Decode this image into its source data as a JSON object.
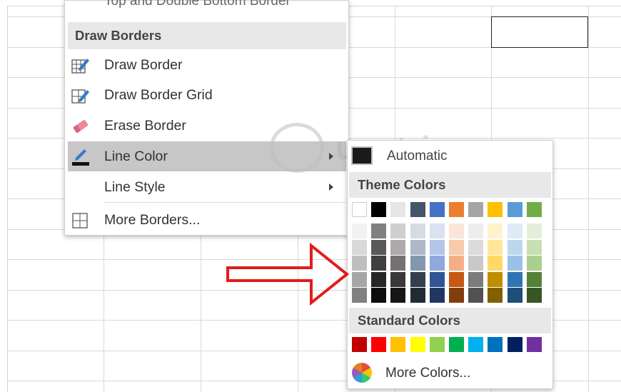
{
  "borders_menu": {
    "partial_top_label": "Top and Double Bottom Border",
    "section_header": "Draw Borders",
    "items": [
      {
        "label": "Draw Border",
        "icon": "pencil-grid-icon"
      },
      {
        "label": "Draw Border Grid",
        "icon": "pencil-grid-icon"
      },
      {
        "label": "Erase Border",
        "icon": "eraser-icon"
      },
      {
        "label": "Line Color",
        "icon": "pencil-line-color-icon",
        "highlighted": true,
        "has_submenu": true
      },
      {
        "label": "Line Style",
        "icon": "",
        "has_submenu": true
      },
      {
        "label": "More Borders...",
        "icon": "grid-icon"
      }
    ]
  },
  "color_menu": {
    "automatic_label": "Automatic",
    "theme_header": "Theme Colors",
    "standard_header": "Standard Colors",
    "more_colors_label": "More Colors...",
    "theme_base": [
      "#FFFFFF",
      "#000000",
      "#E7E6E6",
      "#44546A",
      "#4472C4",
      "#ED7D31",
      "#A5A5A5",
      "#FFC000",
      "#5B9BD5",
      "#70AD47"
    ],
    "theme_shades": [
      [
        "#F2F2F2",
        "#D9D9D9",
        "#BFBFBF",
        "#A6A6A6",
        "#808080"
      ],
      [
        "#808080",
        "#595959",
        "#404040",
        "#262626",
        "#0D0D0D"
      ],
      [
        "#D0CECE",
        "#AEAAAA",
        "#757171",
        "#3A3838",
        "#171616"
      ],
      [
        "#D6DCE4",
        "#ADB9CA",
        "#8497B0",
        "#333F4F",
        "#222B35"
      ],
      [
        "#D9E1F2",
        "#B4C6E7",
        "#8EA9DB",
        "#305496",
        "#203764"
      ],
      [
        "#FCE4D6",
        "#F8CBAD",
        "#F4B084",
        "#C65911",
        "#833C0B"
      ],
      [
        "#EDEDED",
        "#DBDBDB",
        "#C9C9C9",
        "#7B7B7B",
        "#525252"
      ],
      [
        "#FFF2CC",
        "#FFE699",
        "#FFD966",
        "#BF8F00",
        "#806000"
      ],
      [
        "#DDEBF7",
        "#BDD7EE",
        "#9BC2E6",
        "#2F75B5",
        "#1F4E78"
      ],
      [
        "#E2EFDA",
        "#C6E0B4",
        "#A9D08E",
        "#548235",
        "#375623"
      ]
    ],
    "standard": [
      "#C00000",
      "#FF0000",
      "#FFC000",
      "#FFFF00",
      "#92D050",
      "#00B050",
      "#00B0F0",
      "#0070C0",
      "#002060",
      "#7030A0"
    ]
  },
  "watermark": {
    "text": "uantrimang"
  },
  "accent": {
    "arrow": "#e31b1b",
    "highlight": "#c7c7c7"
  }
}
